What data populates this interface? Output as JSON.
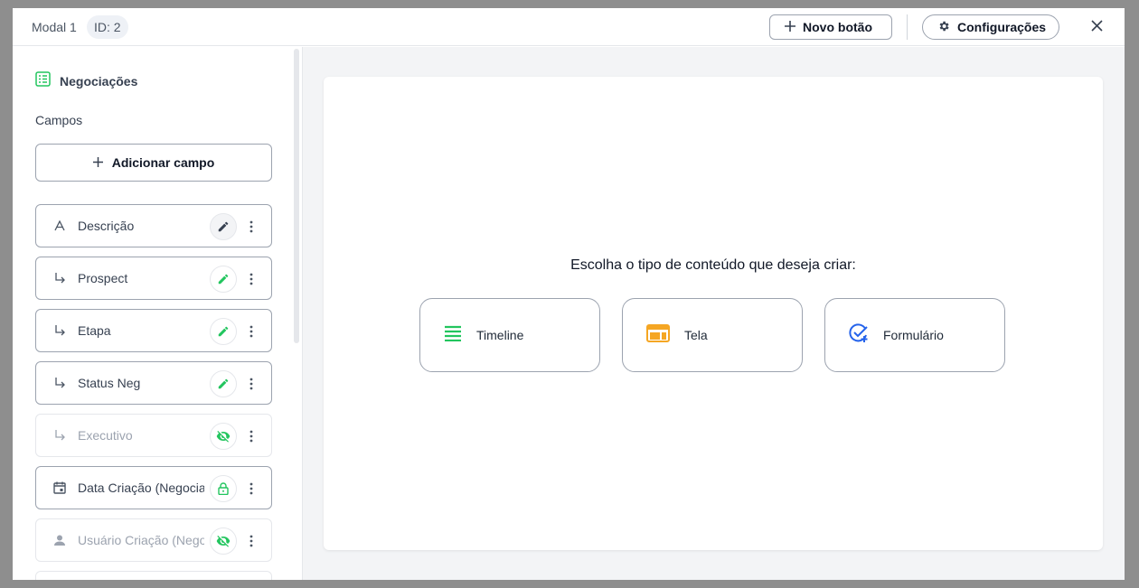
{
  "header": {
    "title": "Modal 1",
    "id_badge": "ID: 2",
    "new_button_label": "Novo botão",
    "settings_button_label": "Configurações"
  },
  "sidebar": {
    "heading": "Negociações",
    "section_label": "Campos",
    "add_field_label": "Adicionar campo",
    "fields": [
      {
        "name": "Descrição",
        "icon": "text-a-icon",
        "action": "edit-icon",
        "state": "active"
      },
      {
        "name": "Prospect",
        "icon": "subdirectory-arrow-icon",
        "action": "edit-icon",
        "state": "normal"
      },
      {
        "name": "Etapa",
        "icon": "subdirectory-arrow-icon",
        "action": "edit-icon",
        "state": "normal"
      },
      {
        "name": "Status Neg",
        "icon": "subdirectory-arrow-icon",
        "action": "edit-icon",
        "state": "normal"
      },
      {
        "name": "Executivo",
        "icon": "subdirectory-arrow-icon",
        "action": "eye-off-icon",
        "state": "hidden"
      },
      {
        "name": "Data Criação (Negociações)",
        "icon": "calendar-icon",
        "action": "lock-icon",
        "state": "locked"
      },
      {
        "name": "Usuário Criação (Negociações)",
        "icon": "person-icon",
        "action": "eye-off-icon",
        "state": "hidden"
      }
    ]
  },
  "main": {
    "prompt": "Escolha o tipo de conteúdo que deseja criar:",
    "options": [
      {
        "label": "Timeline",
        "icon": "timeline-icon",
        "color": "#22c55e"
      },
      {
        "label": "Tela",
        "icon": "screen-layout-icon",
        "color": "#f5a623"
      },
      {
        "label": "Formulário",
        "icon": "form-check-icon",
        "color": "#2563eb"
      }
    ]
  },
  "colors": {
    "accent_green": "#22c55e",
    "border": "#9ca3af",
    "muted_text": "#9ca3af"
  }
}
